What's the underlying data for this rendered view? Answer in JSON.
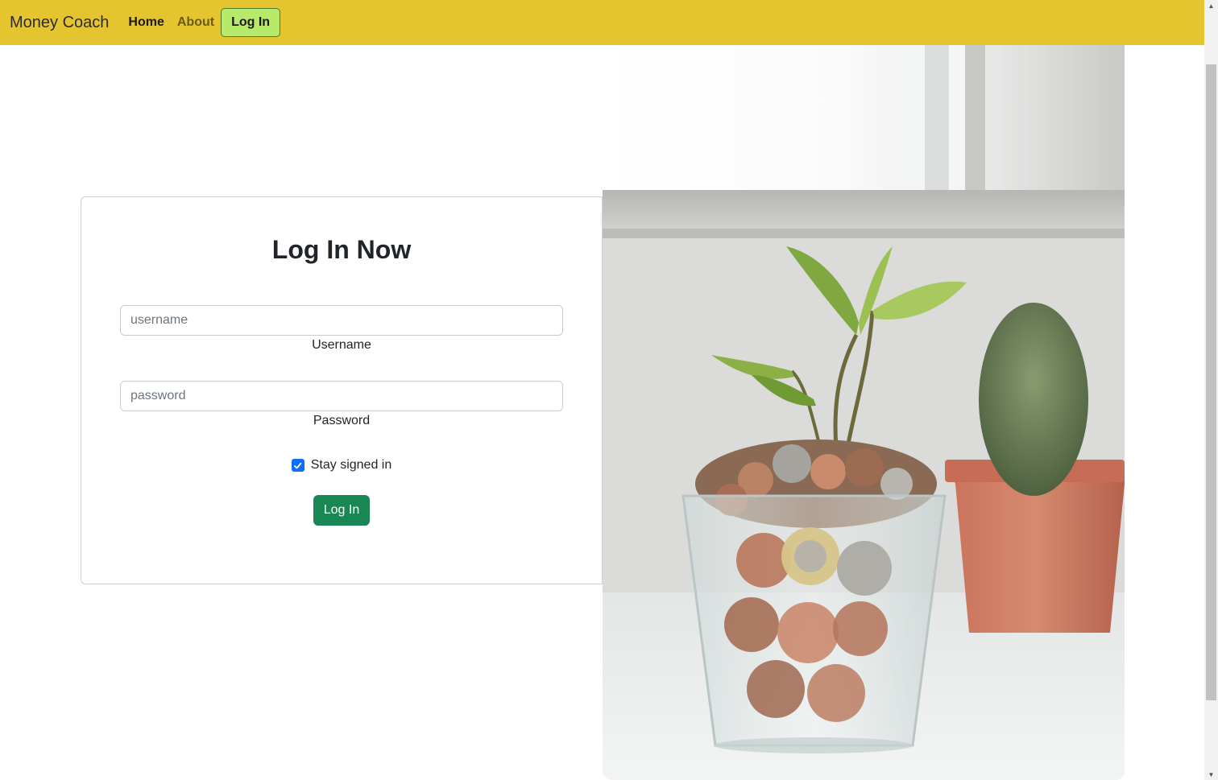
{
  "navbar": {
    "brand": "Money Coach",
    "links": [
      {
        "label": "Home"
      },
      {
        "label": "About"
      }
    ],
    "login_button": "Log In"
  },
  "form": {
    "title": "Log In Now",
    "username": {
      "placeholder": "username",
      "value": "",
      "label": "Username"
    },
    "password": {
      "placeholder": "password",
      "value": "",
      "label": "Password"
    },
    "stay_signed_in": {
      "label": "Stay signed in",
      "checked": true
    },
    "submit_label": "Log In"
  },
  "hero_image": {
    "subject": "plant growing from glass of coins beside potted cactus"
  },
  "icons": {
    "checkbox_check": "check-icon",
    "scroll_up": "chevron-up-icon",
    "scroll_down": "chevron-down-icon"
  },
  "colors": {
    "navbar_bg": "#e4c530",
    "nav_login_btn": "#b7ea6a",
    "submit_btn": "#198754",
    "checkbox": "#0d6efd"
  }
}
